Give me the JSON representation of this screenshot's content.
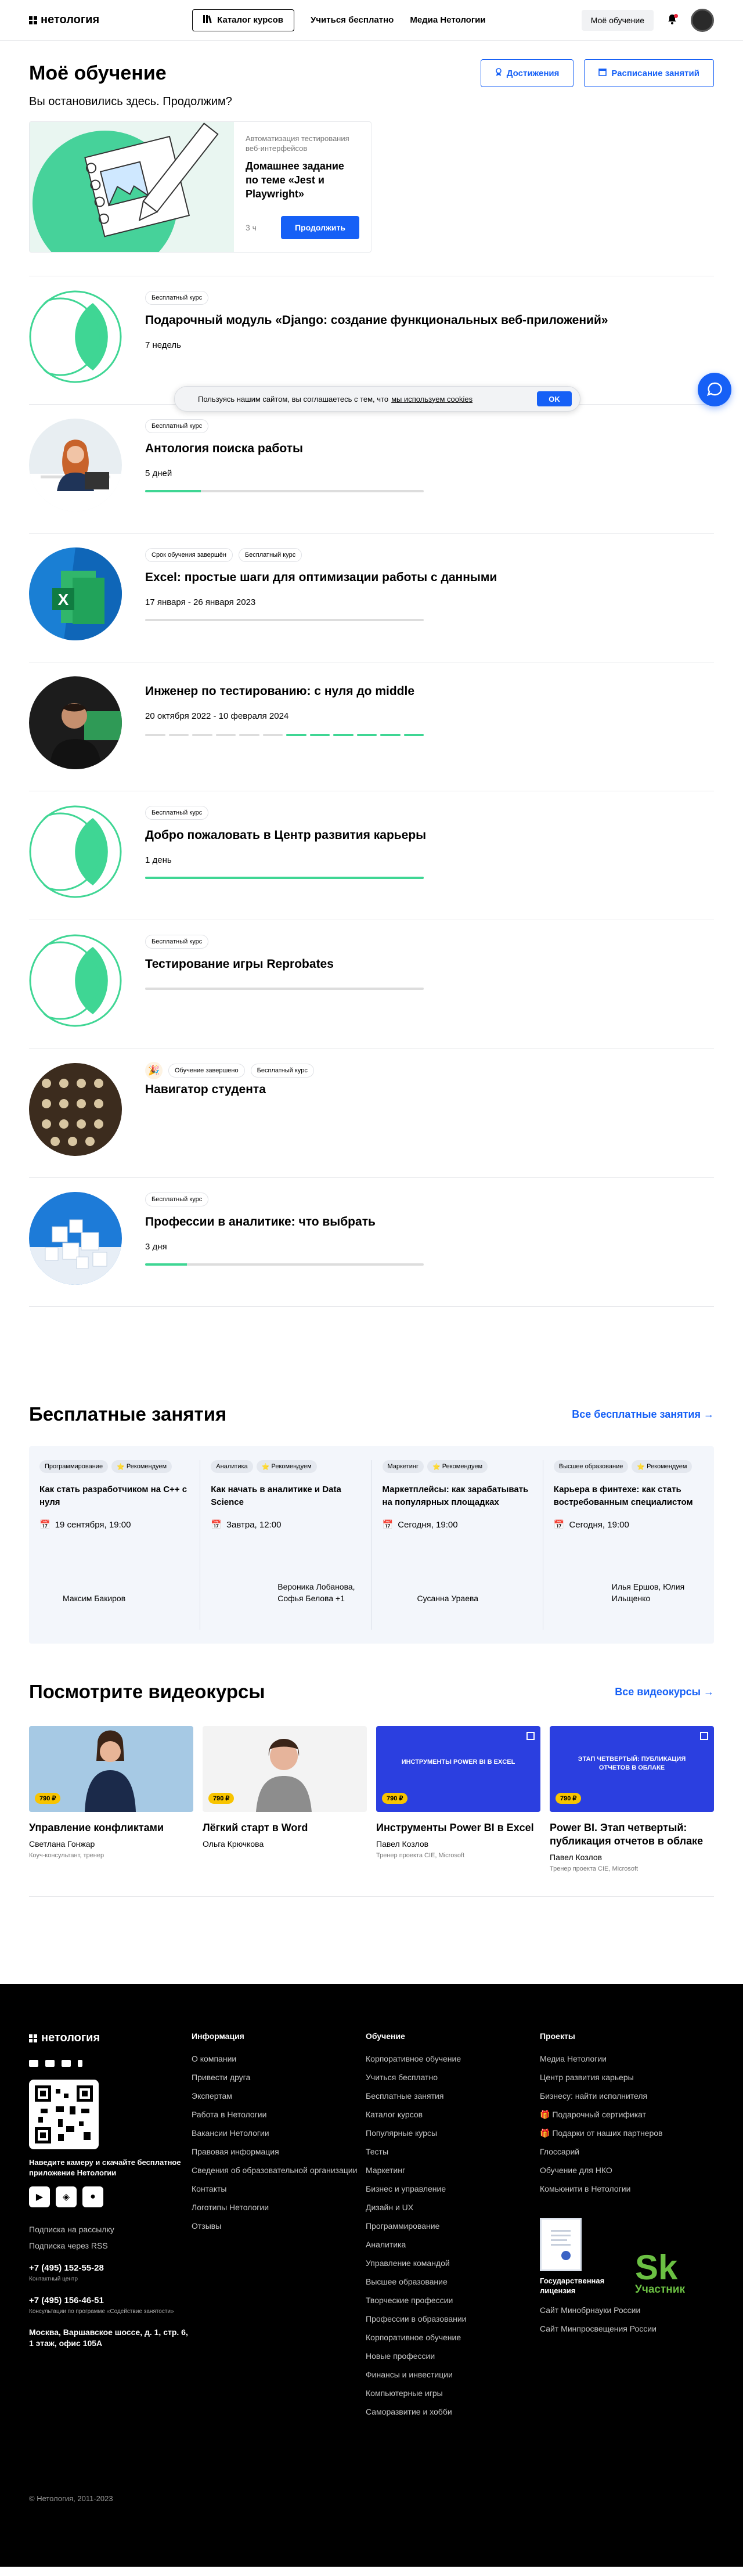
{
  "header": {
    "logo": "нетология",
    "catalog": "Каталог курсов",
    "nav": [
      "Учиться бесплатно",
      "Медиа Нетологии"
    ],
    "my_learning": "Моё обучение"
  },
  "page": {
    "title": "Моё обучение",
    "achievements": "Достижения",
    "schedule": "Расписание занятий",
    "continue_q": "Вы остановились здесь. Продолжим?"
  },
  "continue_card": {
    "meta": "Автоматизация тестирования веб-интерфейсов",
    "title": "Домашнее задание по теме «Jest и Playwright»",
    "duration": "3 ч",
    "button": "Продолжить"
  },
  "courses": [
    {
      "tags": [
        "Бесплатный курс"
      ],
      "title": "Подарочный модуль «Django: создание функциональных веб-приложений»",
      "duration": "7 недель",
      "progress": 0
    },
    {
      "tags": [
        "Бесплатный курс"
      ],
      "title": "Антология поиска работы",
      "duration": "5 дней",
      "progress": 0.2
    },
    {
      "tags": [
        "Срок обучения завершён",
        "Бесплатный курс"
      ],
      "title": "Excel: простые шаги для оптимизации работы с данными",
      "duration": "17 января - 26 января 2023",
      "progress": 0
    },
    {
      "tags": [],
      "title": "Инженер по тестированию: с нуля до middle",
      "duration": "20 октября 2022 - 10 февраля 2024",
      "progress": 0.5
    },
    {
      "tags": [
        "Бесплатный курс"
      ],
      "title": "Добро пожаловать в Центр развития карьеры",
      "duration": "1 день",
      "progress": 1
    },
    {
      "tags": [
        "Бесплатный курс"
      ],
      "title": "Тестирование игры Reprobates",
      "duration": "",
      "progress": 0
    },
    {
      "tags": [
        "Обучение завершено",
        "Бесплатный курс"
      ],
      "title": "Навигатор студента",
      "duration": "",
      "progress": null
    },
    {
      "tags": [
        "Бесплатный курс"
      ],
      "title": "Профессии в аналитике: что выбрать",
      "duration": "3 дня",
      "progress": 0.15
    }
  ],
  "cookie": {
    "text": "Пользуясь нашим сайтом, вы соглашаетесь с тем, что",
    "link": "мы используем cookies",
    "ok": "OK"
  },
  "free": {
    "title": "Бесплатные занятия",
    "all": "Все бесплатные занятия →",
    "recommend": "Рекомендуем",
    "cards": [
      {
        "cat": "Программирование",
        "title": "Как стать разработчиком на C++ с нуля",
        "date": "19 сентября, 19:00",
        "authors": "Максим Бакиров"
      },
      {
        "cat": "Аналитика",
        "title": "Как начать в аналитике и Data Science",
        "date": "Завтра, 12:00",
        "authors": "Вероника Лобанова, Софья Белова +1"
      },
      {
        "cat": "Маркетинг",
        "title": "Маркетплейсы: как зарабатывать на популярных площадках",
        "date": "Сегодня, 19:00",
        "authors": "Сусанна Ураева"
      },
      {
        "cat": "Высшее образование",
        "title": "Карьера в финтехе: как стать востребованным специалистом",
        "date": "Сегодня, 19:00",
        "authors": "Илья Ершов, Юлия Ильщенко"
      }
    ]
  },
  "videos": {
    "title": "Посмотрите видеокурсы",
    "all": "Все видеокурсы →",
    "cards": [
      {
        "price": "790 ₽",
        "title": "Управление конфликтами",
        "author": "Светлана Гонжар",
        "role": "Коуч-консультант, тренер",
        "banner": ""
      },
      {
        "price": "790 ₽",
        "title": "Лёгкий старт в Word",
        "author": "Ольга Крючкова",
        "role": "",
        "banner": ""
      },
      {
        "price": "790 ₽",
        "title": "Инструменты Power BI в Excel",
        "author": "Павел Козлов",
        "role": "Тренер проекта CIE, Microsoft",
        "banner": "ИНСТРУМЕНТЫ POWER BI В EXCEL"
      },
      {
        "price": "790 ₽",
        "title": "Power BI. Этап четвертый: публикация отчетов в облаке",
        "author": "Павел Козлов",
        "role": "Тренер проекта CIE, Microsoft",
        "banner": "ЭТАП ЧЕТВЕРТЫЙ: ПУБЛИКАЦИЯ ОТЧЕТОВ В ОБЛАКЕ"
      }
    ]
  },
  "footer": {
    "logo": "нетология",
    "qr_text": "Наведите камеру и скачайте бесплатное приложение Нетологии",
    "subscribe": "Подписка на рассылку",
    "rss": "Подписка через RSS",
    "phone1": "+7 (495) 152-55-28",
    "phone1_note": "Контактный центр",
    "phone2": "+7 (495) 156-46-51",
    "phone2_note": "Консультации по программе «Содействие занятости»",
    "address": "Москва, Варшавское шоссе, д. 1, стр. 6, 1 этаж, офис 105А",
    "copyright": "© Нетология, 2011-2023",
    "info": {
      "title": "Информация",
      "links": [
        "О компании",
        "Привести друга",
        "Экспертам",
        "Работа в Нетологии",
        "Вакансии Нетологии",
        "Правовая информация",
        "Сведения об образовательной организации",
        "Контакты",
        "Логотипы Нетологии",
        "Отзывы"
      ]
    },
    "edu": {
      "title": "Обучение",
      "links": [
        "Корпоративное обучение",
        "Учиться бесплатно",
        "Бесплатные занятия",
        "Каталог курсов",
        "Популярные курсы",
        "Тесты",
        "Маркетинг",
        "Бизнес и управление",
        "Дизайн и UX",
        "Программирование",
        "Аналитика",
        "Управление командой",
        "Высшее образование",
        "Творческие профессии",
        "Профессии в образовании",
        "Корпоративное обучение",
        "Новые профессии",
        "Финансы и инвестиции",
        "Компьютерные игры",
        "Саморазвитие и хобби"
      ]
    },
    "proj": {
      "title": "Проекты",
      "links": [
        "Медиа Нетологии",
        "Центр развития карьеры",
        "Бизнесу: найти исполнителя",
        "Подарочный сертификат",
        "Подарки от наших партнеров",
        "Глоссарий",
        "Обучение для НКО",
        "Комьюнити в Нетологии"
      ]
    },
    "license": "Государственная лицензия",
    "sk": "Sk",
    "sk_sub": "Участник",
    "minobr": [
      "Сайт Минобрнауки России",
      "Сайт Минпросвещения России"
    ]
  }
}
